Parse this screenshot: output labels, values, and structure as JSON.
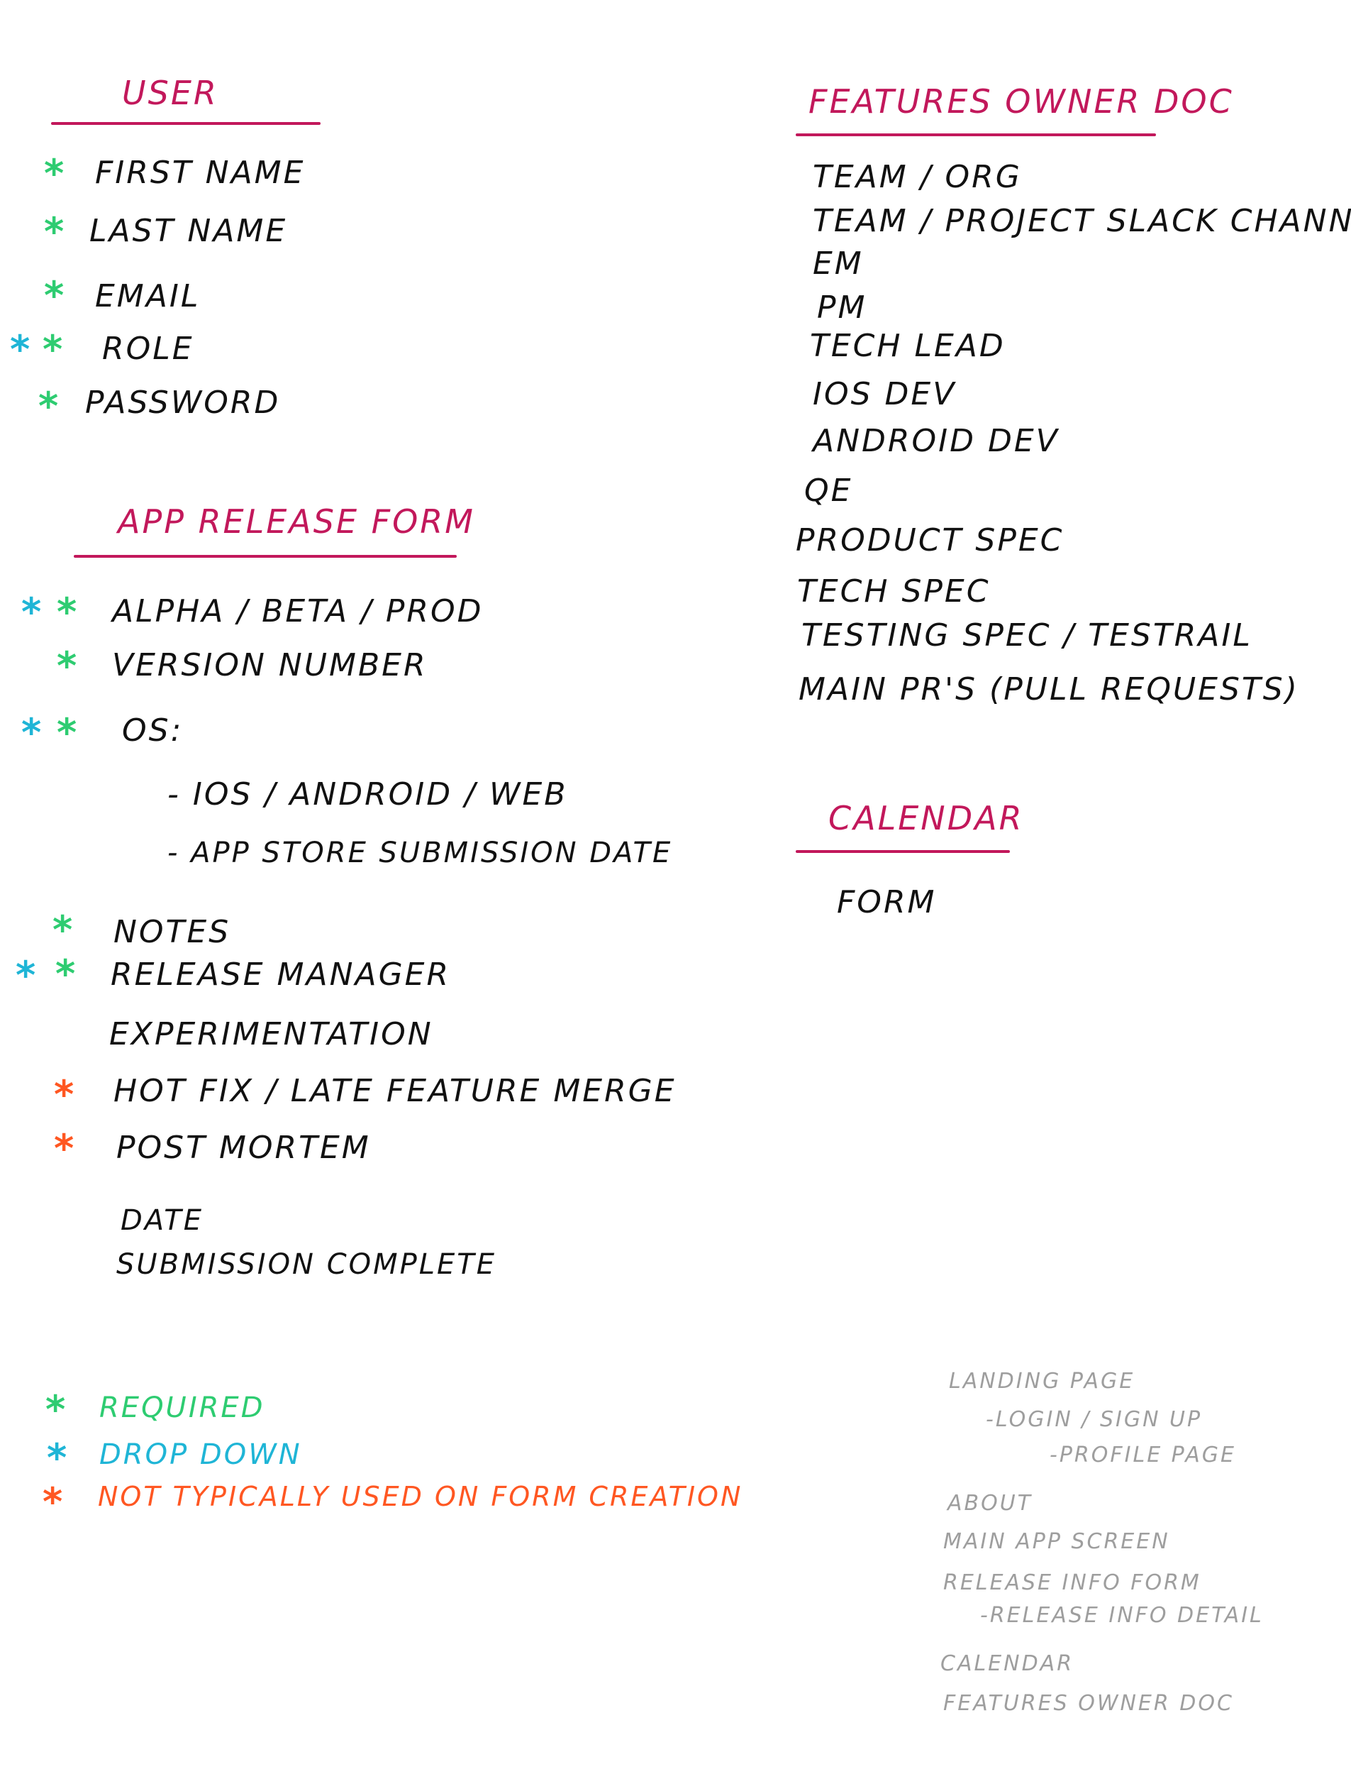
{
  "colors": {
    "title": "#c2185b",
    "text": "#111111",
    "required": "#2ecc71",
    "dropdown": "#1fb5d6",
    "not_typical": "#ff5722",
    "muted": "#9e9e9e"
  },
  "user": {
    "title": "User",
    "fields": [
      "First Name",
      "Last Name",
      "Email",
      "Role",
      "Password"
    ]
  },
  "app_release_form": {
    "title": "App Release Form",
    "fields": [
      "Alpha / Beta / Prod",
      "Version Number",
      "OS:",
      "- iOS / Android / Web",
      "- App Store Submission Date",
      "Notes",
      "Release Manager",
      "Experimentation",
      "Hot Fix / Late Feature Merge",
      "Post Mortem",
      "Date",
      "Submission Complete"
    ]
  },
  "features_owner_doc": {
    "title": "Features Owner Doc",
    "fields": [
      "Team / Org",
      "Team / Project Slack Channel",
      "EM",
      "PM",
      "Tech Lead",
      "iOS Dev",
      "Android Dev",
      "QE",
      "Product Spec",
      "Tech Spec",
      "Testing Spec / TestRail",
      "Main PR's (Pull Requests)"
    ]
  },
  "calendar": {
    "title": "Calendar",
    "fields": [
      "Form"
    ]
  },
  "legend": {
    "symbol": "*",
    "required": "Required",
    "dropdown": "Drop Down",
    "not_typical": "Not Typically Used On Form Creation"
  },
  "pages": {
    "items": [
      "Landing Page",
      "-Login / Sign Up",
      "-Profile Page",
      "About",
      "Main App Screen",
      "Release Info Form",
      "-Release Info Detail",
      "Calendar",
      "Features Owner Doc"
    ]
  }
}
